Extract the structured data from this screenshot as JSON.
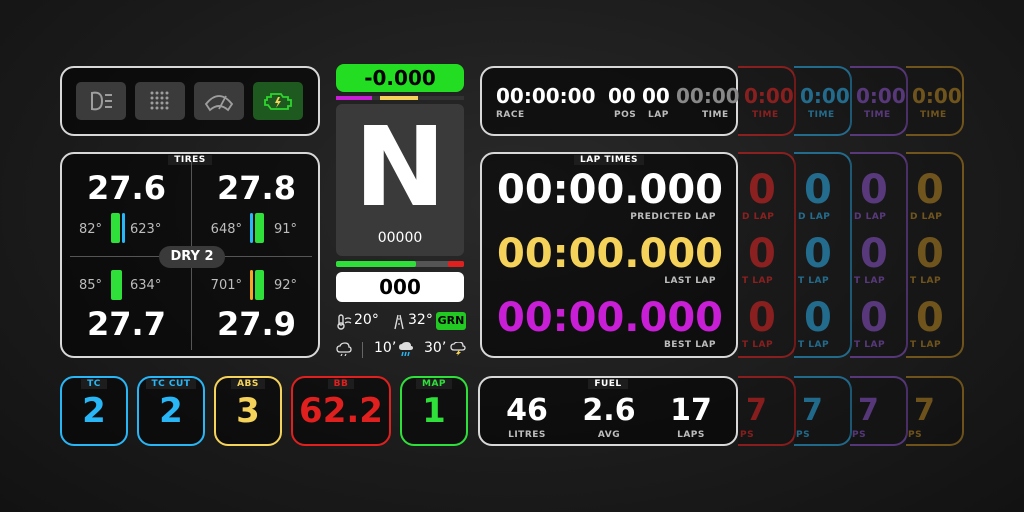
{
  "controls": {
    "icons": [
      "headlight-icon",
      "pit-grid-icon",
      "wiper-icon",
      "engine-icon"
    ],
    "engine_color": "#2ed62e"
  },
  "delta": {
    "value": "-0.000",
    "color": "#22dd22"
  },
  "gear": {
    "value": "N",
    "rpm": "00000",
    "speed": "000"
  },
  "weather": {
    "air": "20°",
    "track": "32°",
    "flag": "GRN",
    "rain_in1": "10’",
    "rain_in2": "30’"
  },
  "race": {
    "race_time": "00:00:00",
    "race_label": "RACE",
    "pos": "00",
    "pos_label": "POS",
    "lap": "00",
    "lap_label": "LAP",
    "time": "00:00",
    "time_label": "TIME"
  },
  "tires": {
    "title": "TIRES",
    "compound": "DRY 2",
    "fl": {
      "pressure": "27.6",
      "temp_left": "82°",
      "temp_right": "623°"
    },
    "fr": {
      "pressure": "27.8",
      "temp_left": "648°",
      "temp_right": "91°"
    },
    "rl": {
      "pressure": "27.7",
      "temp_left": "85°",
      "temp_right": "634°"
    },
    "rr": {
      "pressure": "27.9",
      "temp_left": "701°",
      "temp_right": "92°"
    }
  },
  "lap_times": {
    "title": "LAP TIMES",
    "predicted": "00:00.000",
    "predicted_label": "PREDICTED LAP",
    "last": "00:00.000",
    "last_label": "LAST LAP",
    "best": "00:00.000",
    "best_label": "BEST LAP",
    "colors": {
      "predicted": "#ffffff",
      "last": "#f5d35a",
      "best": "#c81fd6"
    }
  },
  "assists": {
    "tc": {
      "label": "TC",
      "value": "2",
      "color": "#29b6f6"
    },
    "tc_cut": {
      "label": "TC CUT",
      "value": "2",
      "color": "#29b6f6"
    },
    "abs": {
      "label": "ABS",
      "value": "3",
      "color": "#f5d35a"
    },
    "bb": {
      "label": "BB",
      "value": "62.2",
      "color": "#e0201f"
    },
    "map": {
      "label": "MAP",
      "value": "1",
      "color": "#2fe03a"
    }
  },
  "fuel": {
    "title": "FUEL",
    "litres": "46",
    "litres_label": "LITRES",
    "avg": "2.6",
    "avg_label": "AVG",
    "laps": "17",
    "laps_label": "LAPS"
  },
  "ghost_columns": [
    {
      "color": "#e0201f",
      "time_top": "0:00",
      "time_label": "TIME",
      "big": "0",
      "lap_a": "D LAP",
      "lap_b": "T LAP",
      "lap_c": "T LAP",
      "fuel_val": "7",
      "fuel_label": "PS"
    },
    {
      "color": "#29b6f6",
      "time_top": "0:00",
      "time_label": "TIME",
      "big": "0",
      "lap_a": "D LAP",
      "lap_b": "T LAP",
      "lap_c": "T LAP",
      "fuel_val": "7",
      "fuel_label": "PS"
    },
    {
      "color": "#9b59e6",
      "time_top": "0:00",
      "time_label": "TIME",
      "big": "0",
      "lap_a": "D LAP",
      "lap_b": "T LAP",
      "lap_c": "T LAP",
      "fuel_val": "7",
      "fuel_label": "PS"
    },
    {
      "color": "#e0a020",
      "time_top": "0:00",
      "time_label": "TIME",
      "big": "0",
      "lap_a": "D LAP",
      "lap_b": "T LAP",
      "lap_c": "T LAP",
      "fuel_val": "7",
      "fuel_label": "PS"
    }
  ]
}
